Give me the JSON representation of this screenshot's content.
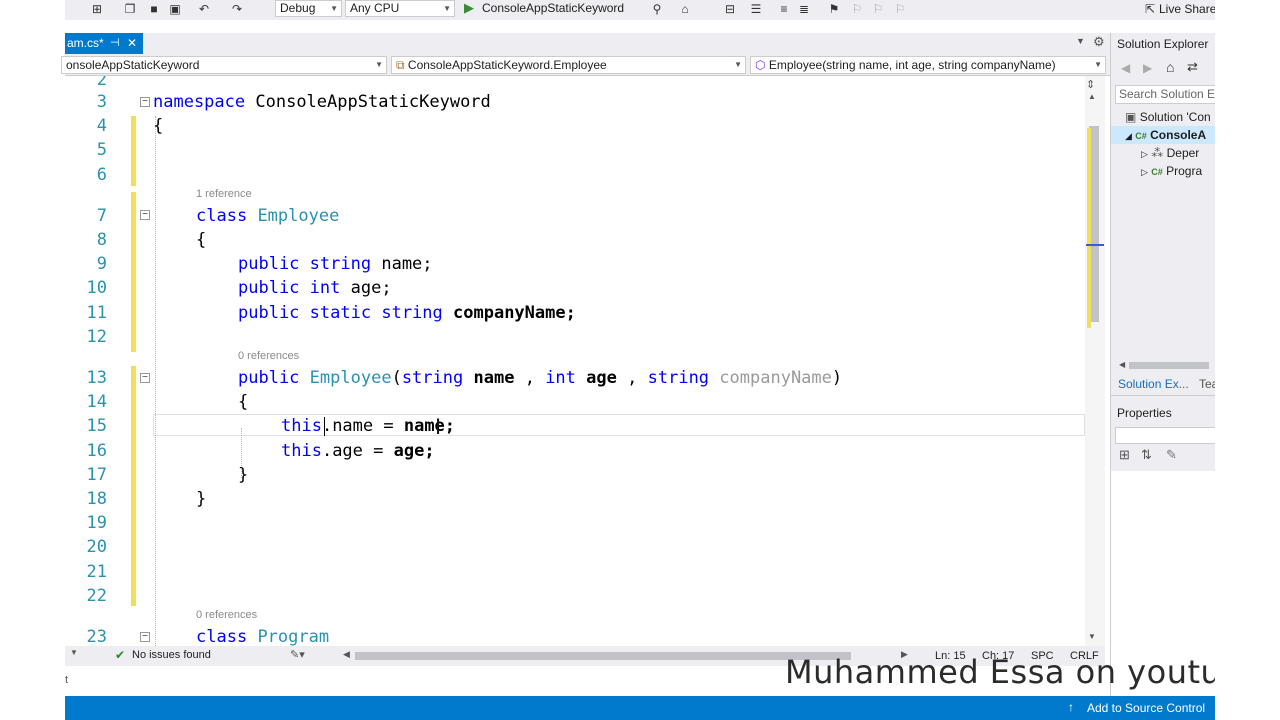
{
  "toolbar": {
    "config": "Debug",
    "platform": "Any CPU",
    "run_target": "ConsoleAppStaticKeyword",
    "live_share": "Live Share"
  },
  "tab": {
    "label": "am.cs*",
    "pin": "⊣",
    "close": "✕"
  },
  "navbar": {
    "project": "onsoleAppStaticKeyword",
    "type": "ConsoleAppStaticKeyword.Employee",
    "member": "Employee(string name, int age, string companyName)"
  },
  "editor": {
    "lines": [
      {
        "n": "2"
      },
      {
        "n": "3"
      },
      {
        "n": "4"
      },
      {
        "n": "5"
      },
      {
        "n": "6"
      },
      {
        "n": "7"
      },
      {
        "n": "8"
      },
      {
        "n": "9"
      },
      {
        "n": "10"
      },
      {
        "n": "11"
      },
      {
        "n": "12"
      },
      {
        "n": "13"
      },
      {
        "n": "14"
      },
      {
        "n": "15"
      },
      {
        "n": "16"
      },
      {
        "n": "17"
      },
      {
        "n": "18"
      },
      {
        "n": "19"
      },
      {
        "n": "20"
      },
      {
        "n": "21"
      },
      {
        "n": "22"
      },
      {
        "n": "23"
      }
    ],
    "code": {
      "ns_kw": "namespace",
      "ns_name": "ConsoleAppStaticKeyword",
      "brace_open": "{",
      "brace_close": "}",
      "lens_employee": "1 reference",
      "class_kw": "class",
      "class_employee": "Employee",
      "public_kw": "public",
      "string_kw": "string",
      "int_kw": "int",
      "static_kw": "static",
      "field_name": "name;",
      "field_age": "age;",
      "field_company": "companyName;",
      "lens_ctor": "0 references",
      "ctor_name": "Employee",
      "paren_open": "(",
      "param_name": "name",
      "comma": ",",
      "param_age": "age",
      "param_company": "companyName",
      "paren_close": ")",
      "this_kw": "this",
      "assign_name": ".name = ",
      "assign_name_rhs": "name;",
      "assign_age": ".age = ",
      "assign_age_rhs": "age;",
      "lens_program": "0 references",
      "class_program": "Program"
    }
  },
  "status_edit": {
    "issues": "No issues found",
    "ln": "Ln: 15",
    "ch": "Ch: 17",
    "spc": "SPC",
    "crlf": "CRLF"
  },
  "solution_explorer": {
    "title": "Solution Explorer",
    "search": "Search Solution Ex",
    "items": [
      {
        "label": "Solution 'Con"
      },
      {
        "label": "ConsoleA"
      },
      {
        "label": "Deper"
      },
      {
        "label": "Progra"
      }
    ],
    "tabs": [
      "Solution Ex...",
      "Tea"
    ],
    "properties": "Properties"
  },
  "bottombar": {
    "source_control": "Add to Source Control"
  },
  "watermark": "Muhammed Essa on youtu",
  "output_prompt": "t",
  "colors": {
    "accent": "#007acc",
    "keyword": "#0000ff",
    "type": "#2b91af",
    "change_bar": "#efe05a"
  }
}
